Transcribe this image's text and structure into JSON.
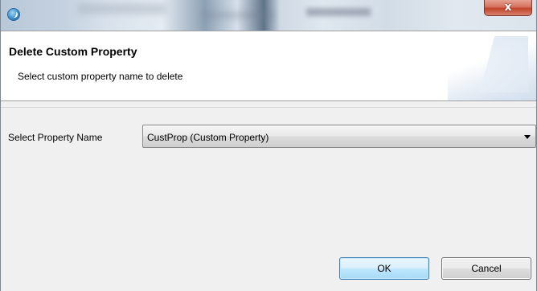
{
  "window": {
    "close_label": "x"
  },
  "header": {
    "title": "Delete Custom Property",
    "description": "Select custom property name to delete"
  },
  "form": {
    "property_label": "Select Property Name",
    "property_selected": "CustProp (Custom Property)"
  },
  "buttons": {
    "ok_label": "OK",
    "cancel_label": "Cancel"
  },
  "colors": {
    "close_button": "#c2432a",
    "default_button_border": "#3c7fb1",
    "dialog_background": "#f0f0f0"
  }
}
